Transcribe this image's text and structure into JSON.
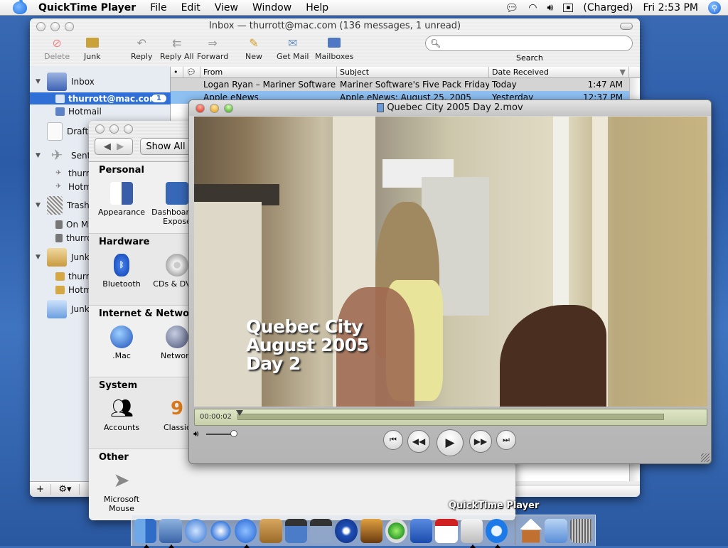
{
  "menubar": {
    "app_name": "QuickTime Player",
    "items": [
      "File",
      "Edit",
      "View",
      "Window",
      "Help"
    ],
    "status": {
      "battery": "(Charged)",
      "clock": "Fri 2:53 PM"
    },
    "icons": [
      "ichat-icon",
      "wifi-icon",
      "volume-icon",
      "battery-icon",
      "spotlight-icon"
    ]
  },
  "mail": {
    "title": "Inbox — thurrott@mac.com (136 messages, 1 unread)",
    "toolbar": {
      "delete": "Delete",
      "junk": "Junk",
      "reply": "Reply",
      "reply_all": "Reply All",
      "forward": "Forward",
      "new": "New",
      "get_mail": "Get Mail",
      "mailboxes": "Mailboxes",
      "search_label": "Search",
      "search_value": ""
    },
    "sidebar": {
      "inbox": "Inbox",
      "inbox_accounts": [
        {
          "label": "thurrott@mac.com",
          "unread": "1"
        },
        {
          "label": "Hotmail"
        }
      ],
      "drafts": "Drafts",
      "sent": "Sent",
      "sent_accounts": [
        "thurrott@mac.com",
        "Hotmail"
      ],
      "trash": "Trash",
      "trash_accounts": [
        "On My Mac",
        "thurrott@mac.com"
      ],
      "junk": "Junk",
      "junk_accounts": [
        "thurrott@mac.com",
        "Hotmail"
      ],
      "junk_folder": "Junk E-mail",
      "add_label": "+",
      "action_label": "⚙▾"
    },
    "columns": {
      "from": "From",
      "subject": "Subject",
      "date": "Date Received"
    },
    "messages": [
      {
        "from": "Logan Ryan – Mariner Software",
        "subject": "Mariner Software's Five Pack Friday",
        "day": "Today",
        "time": "1:47 AM"
      },
      {
        "from": "Apple eNews",
        "subject": "Apple eNews: August 25, 2005",
        "day": "Yesterday",
        "time": "12:37 PM"
      }
    ]
  },
  "prefs": {
    "show_all": "Show All",
    "sections": [
      {
        "title": "Personal",
        "items": [
          "Appearance",
          "Dashboard & Exposé"
        ]
      },
      {
        "title": "Hardware",
        "items": [
          "Bluetooth",
          "CDs & DVDs"
        ]
      },
      {
        "title": "Internet & Network",
        "items": [
          ".Mac",
          "Network"
        ]
      },
      {
        "title": "System",
        "items": [
          "Accounts",
          "Classic"
        ]
      },
      {
        "title": "Other",
        "items": [
          "Microsoft Mouse"
        ]
      }
    ]
  },
  "quicktime": {
    "title": "Quebec City 2005 Day 2.mov",
    "caption": [
      "Quebec City",
      "August 2005",
      "Day 2"
    ],
    "timecode": "00:00:02",
    "progress": 0.0,
    "volume": 0.85,
    "controls": [
      "go-to-start",
      "rewind",
      "play",
      "fast-forward",
      "go-to-end"
    ]
  },
  "dock": {
    "hover_label": "QuickTime Player",
    "apps": [
      "Finder",
      "Mail",
      "Safari",
      "Sherlock",
      "iChat",
      "Address Book",
      "iMovie",
      "iPhoto",
      "DVD Player",
      "Image Capture",
      "iTunes",
      "Word",
      "iCal",
      "System Preferences",
      "QuickTime Player"
    ],
    "others": [
      "Home",
      "Applications",
      "Trash"
    ]
  }
}
